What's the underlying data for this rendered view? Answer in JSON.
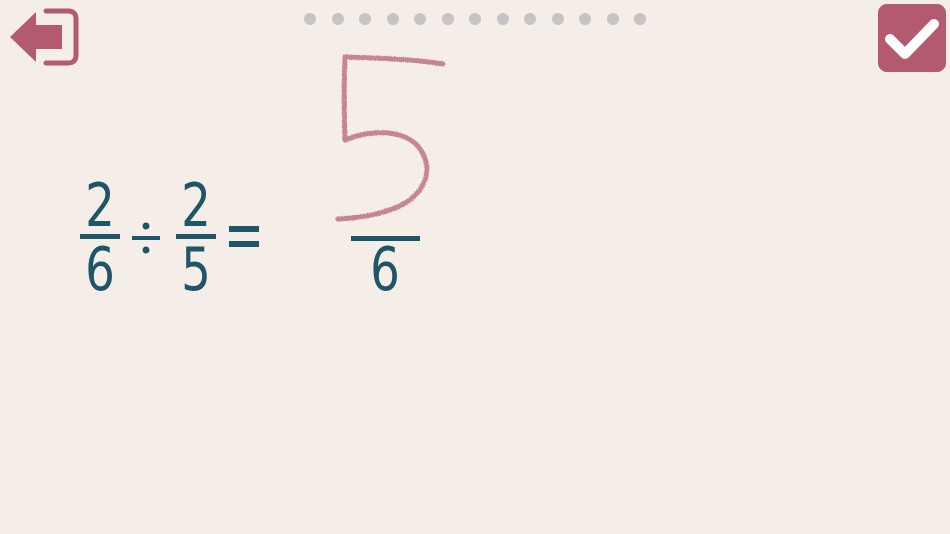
{
  "toolbar": {
    "back_icon": "exit-arrow-icon",
    "check_icon": "checkmark-icon"
  },
  "progress": {
    "total_steps": 13,
    "current_step": 0
  },
  "problem": {
    "left": {
      "numerator": "2",
      "denominator": "6"
    },
    "operator": "÷",
    "right": {
      "numerator": "2",
      "denominator": "5"
    },
    "equals": "="
  },
  "answer": {
    "numerator_handwritten": "5",
    "denominator": "6"
  },
  "colors": {
    "background": "#f5eee8",
    "accent": "#b35a71",
    "text": "#1e5668",
    "dot": "#c4c4c4",
    "ink": "#c27a8d"
  }
}
